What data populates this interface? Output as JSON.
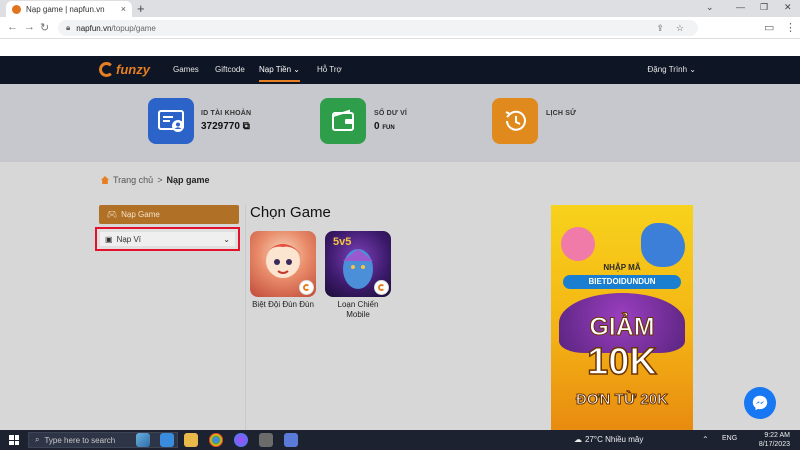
{
  "browser": {
    "tab_title": "Nạp game | napfun.vn",
    "tab_close": "×",
    "new_tab": "+",
    "url_host": "napfun.vn",
    "url_path": "/topup/game",
    "window_minimize": "⌄",
    "window_restore": "—",
    "window_max": "❐",
    "window_close": "✕"
  },
  "site": {
    "logo_text": "funzy",
    "nav": [
      {
        "label": "Games"
      },
      {
        "label": "Giftcode"
      },
      {
        "label": "Nạp Tiền"
      },
      {
        "label": "Hỗ Trợ"
      }
    ],
    "user_name": "Đặng Trình"
  },
  "stats": {
    "account_label": "ID TÀI KHOẢN",
    "account_value": "3729770",
    "balance_label": "SỐ DƯ VÍ",
    "balance_value": "0",
    "balance_unit": "FUN",
    "history_label": "LỊCH SỬ",
    "colors": {
      "account": "#2b63c9",
      "balance": "#2e9e4b",
      "history": "#e08a1e"
    }
  },
  "breadcrumb": {
    "home": "Trang chủ",
    "separator": ">",
    "current": "Nạp game"
  },
  "sidebar": {
    "nap_game_label": "Nạp Game",
    "nap_vi_label": "Nạp Ví"
  },
  "main": {
    "heading": "Chọn Game",
    "games": [
      {
        "name": "Biệt Đội Đùn Đùn"
      },
      {
        "name": "Loạn Chiến Mobile"
      }
    ]
  },
  "ad": {
    "top_line": "NHẬP MÃ",
    "code": "BIETDOIDUNDUN",
    "line_big1": "GIẢM",
    "line_big2": "10K",
    "line_big3": "ĐƠN TỪ 20K"
  },
  "taskbar": {
    "search_placeholder": "Type here to search",
    "weather": "27°C  Nhiều mây",
    "lang": "ENG",
    "time": "9:22 AM",
    "date": "8/17/2023"
  }
}
